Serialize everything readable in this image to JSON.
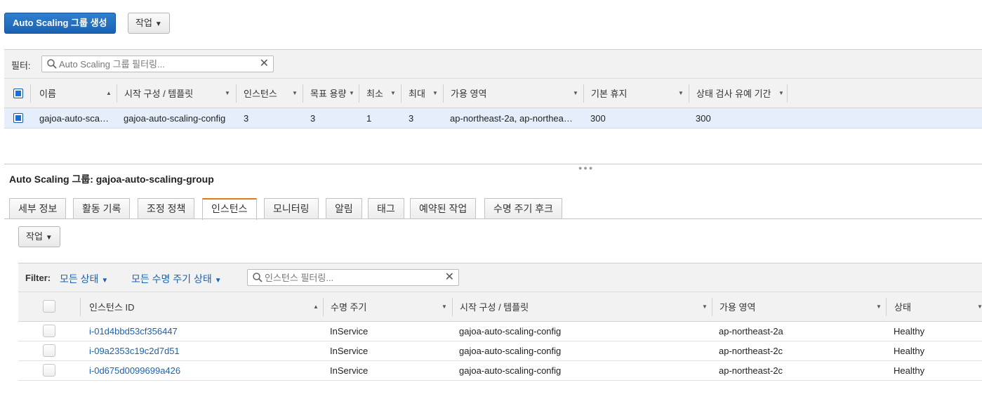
{
  "toolbar": {
    "create_label": "Auto Scaling 그룹 생성",
    "actions_label": "작업"
  },
  "group_filter": {
    "label": "필터:",
    "placeholder": "Auto Scaling 그룹 필터링..."
  },
  "group_table": {
    "columns": [
      "이름",
      "시작 구성 / 템플릿",
      "인스턴스",
      "목표 용량",
      "최소",
      "최대",
      "가용 영역",
      "기본 휴지",
      "상태 검사 유예 기간"
    ],
    "row": {
      "name": "gajoa-auto-sca…",
      "launch_config": "gajoa-auto-scaling-config",
      "instances": "3",
      "desired": "3",
      "min": "1",
      "max": "3",
      "availability_zones": "ap-northeast-2a, ap-northea…",
      "default_cooldown": "300",
      "health_check_grace": "300"
    }
  },
  "detail": {
    "title": "Auto Scaling 그룹: gajoa-auto-scaling-group",
    "tabs": [
      "세부 정보",
      "활동 기록",
      "조정 정책",
      "인스턴스",
      "모니터링",
      "알림",
      "태그",
      "예약된 작업",
      "수명 주기 후크"
    ],
    "active_tab": "인스턴스",
    "actions_label": "작업"
  },
  "instance_filter": {
    "label": "Filter:",
    "state_dropdown": "모든 상태",
    "lifecycle_dropdown": "모든 수명 주기 상태",
    "placeholder": "인스턴스 필터링..."
  },
  "instance_table": {
    "columns": [
      "인스턴스 ID",
      "수명 주기",
      "시작 구성 / 템플릿",
      "가용 영역",
      "상태"
    ],
    "rows": [
      {
        "id": "i-01d4bbd53cf356447",
        "lifecycle": "InService",
        "launch_config": "gajoa-auto-scaling-config",
        "az": "ap-northeast-2a",
        "health": "Healthy"
      },
      {
        "id": "i-09a2353c19c2d7d51",
        "lifecycle": "InService",
        "launch_config": "gajoa-auto-scaling-config",
        "az": "ap-northeast-2c",
        "health": "Healthy"
      },
      {
        "id": "i-0d675d0099699a426",
        "lifecycle": "InService",
        "launch_config": "gajoa-auto-scaling-config",
        "az": "ap-northeast-2c",
        "health": "Healthy"
      }
    ]
  },
  "colors": {
    "primary": "#1a63b3",
    "tab_accent": "#e07b17",
    "selected_row": "#e5eefa"
  },
  "icons": [
    "search-icon",
    "clear-icon",
    "caret-down-icon",
    "sort-asc-icon"
  ]
}
